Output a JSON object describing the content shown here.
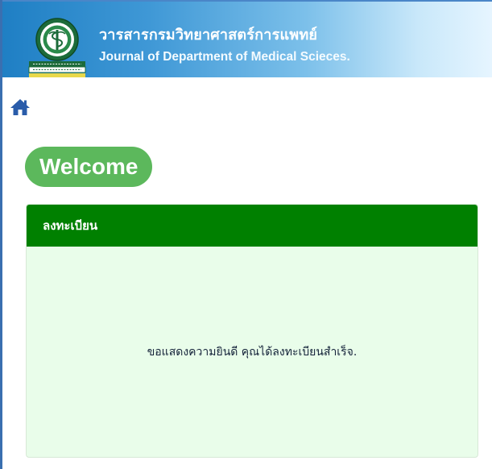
{
  "header": {
    "title_th": "วารสารกรมวิทยาศาสตร์การแพทย์",
    "title_en": "Journal of Department of Medical Scieces.",
    "logo_icon": "department-emblem-icon"
  },
  "nav": {
    "home_icon": "home-icon"
  },
  "welcome": {
    "label": "Welcome"
  },
  "panel": {
    "heading": "ลงทะเบียน",
    "message": "ขอแสดงความยินดี คุณได้ลงทะเบียนสำเร็จ."
  },
  "colors": {
    "header_gradient_start": "#1f7fc4",
    "header_gradient_end": "#e6f5ff",
    "welcome_badge": "#5cb85c",
    "panel_heading": "#008000",
    "panel_body": "#e9fdea",
    "home_icon": "#2a5caa"
  }
}
